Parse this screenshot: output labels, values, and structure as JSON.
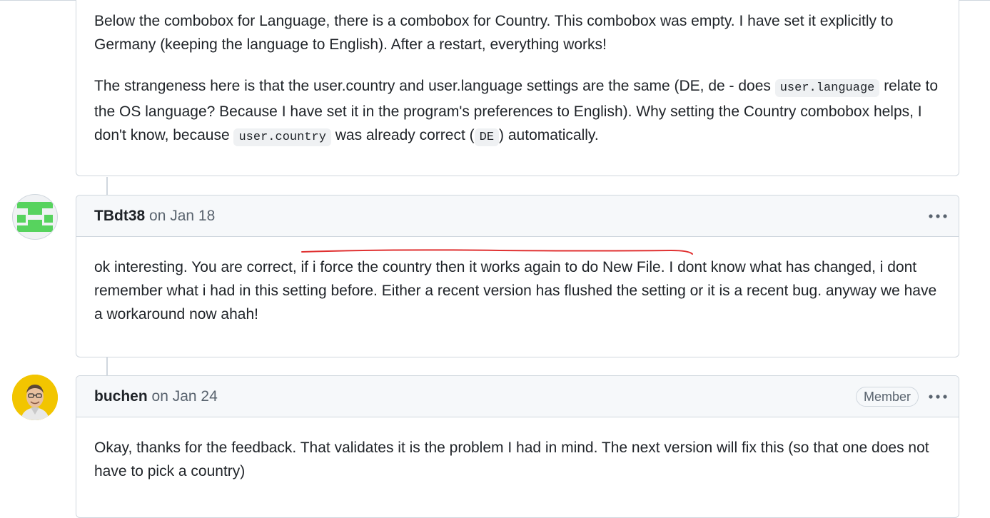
{
  "comments": [
    {
      "paragraphs": [
        {
          "segments": [
            {
              "text": "Below the combobox for Language, there is a combobox for Country. This combobox was empty. I have set it explicitly to Germany (keeping the language to English). After a restart, everything works!"
            }
          ]
        },
        {
          "segments": [
            {
              "text": "The strangeness here is that the user.country and user.language settings are the same (DE, de - does "
            },
            {
              "code": "user.language"
            },
            {
              "text": " relate to the OS language? Because I have set it in the program's preferences to English). Why setting the Country combobox helps, I don't know, because "
            },
            {
              "code": "user.country"
            },
            {
              "text": " was already correct ("
            },
            {
              "code": "DE"
            },
            {
              "text": ") automatically."
            }
          ]
        }
      ]
    },
    {
      "author": "TBdt38",
      "timestamp": "on Jan 18",
      "avatar_icon": "identicon-avatar",
      "avatar_color": "#57d35e",
      "menu_icon": "kebab-horizontal-icon",
      "body": "ok interesting. You are correct, if i force the country then it works again to do New File. I dont know what has changed, i dont remember what i had in this setting before. Either a recent version has flushed the setting or it is a recent bug. anyway we have a workaround now ahah!"
    },
    {
      "author": "buchen",
      "timestamp": "on Jan 24",
      "role_badge": "Member",
      "avatar_icon": "user-photo-avatar",
      "avatar_color": "#f2c500",
      "menu_icon": "kebab-horizontal-icon",
      "body": "Okay, thanks for the feedback. That validates it is the problem I had in mind. The next version will fix this (so that one does not have to pick a country)"
    }
  ],
  "annotation": {
    "icon": "red-underline-annotation",
    "color": "#e03131"
  },
  "colors": {
    "border": "#d0d7de",
    "header_bg": "#f6f8fa",
    "muted_text": "#59636e",
    "text": "#1f2328"
  }
}
